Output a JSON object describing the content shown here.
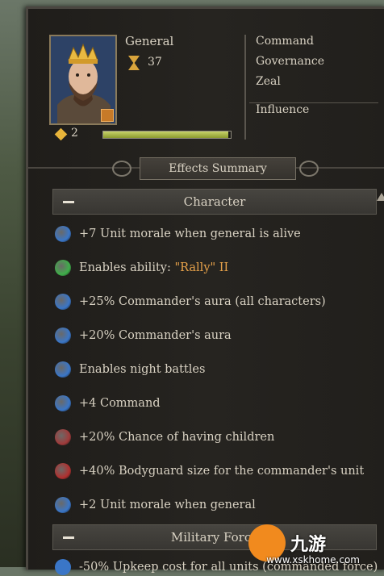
{
  "character": {
    "title": "General",
    "age": "37",
    "rank": "2",
    "rank_progress": 0.98
  },
  "attributes": [
    "Command",
    "Governance",
    "Zeal"
  ],
  "influence_label": "Influence",
  "effects_title": "Effects Summary",
  "sections": {
    "character": "Character",
    "military": "Military Force"
  },
  "effects": [
    {
      "text": "+7 Unit morale when general is alive",
      "icon": "morale-sword-icon",
      "color": "#3a76c7"
    },
    {
      "text_prefix": "Enables ability: ",
      "highlight": "\"Rally\" II",
      "icon": "ability-green-icon",
      "color": "#3fae4a"
    },
    {
      "text": "+25% Commander's aura (all characters)",
      "icon": "morale-sword-icon",
      "color": "#3a76c7"
    },
    {
      "text": "+20% Commander's aura",
      "icon": "morale-sword-icon",
      "color": "#3a76c7"
    },
    {
      "text": "Enables night battles",
      "icon": "moon-icon",
      "color": "#3a76c7"
    },
    {
      "text": "+4 Command",
      "icon": "star-icon",
      "color": "#3a76c7"
    },
    {
      "text": "+20% Chance of having children",
      "icon": "family-icon",
      "color": "#a03b3b"
    },
    {
      "text": "+40% Bodyguard size for the commander's unit",
      "icon": "shield-icon",
      "color": "#b0302f"
    },
    {
      "text": "+2 Unit morale when general",
      "icon": "morale-sword-icon",
      "color": "#3a76c7"
    }
  ],
  "last_effect_partial": "-50% Upkeep cost for all units (commanded force)",
  "watermark": {
    "text": "九游",
    "url": "www.xskhome.com"
  }
}
